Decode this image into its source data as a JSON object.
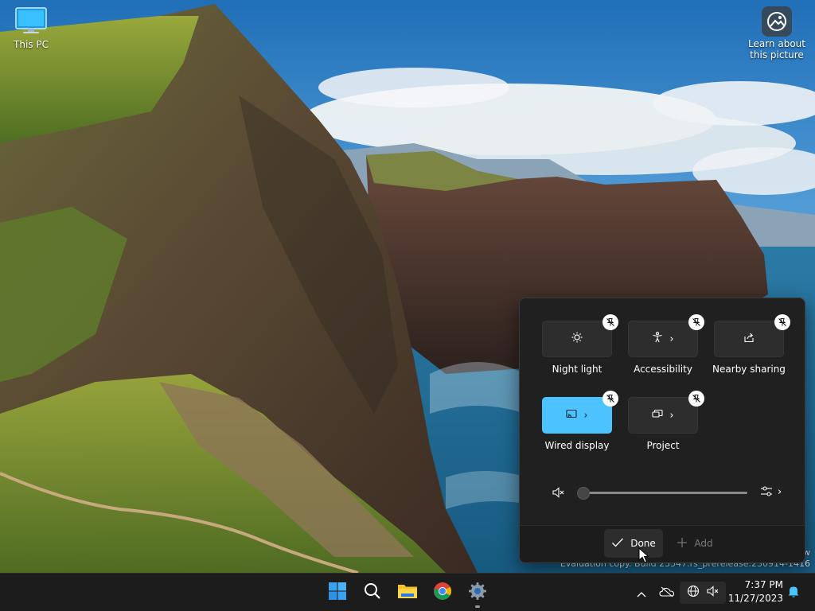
{
  "desktop": {
    "icons": [
      {
        "label": "This PC",
        "icon": "this-pc-icon"
      },
      {
        "label": "Learn about\nthis picture",
        "icon": "learn-picture-icon"
      }
    ],
    "watermark_line1": "w",
    "watermark_line2": "Evaluation copy. Build 23547.rs_prerelease.230914-1416"
  },
  "quick_settings": {
    "mode": "edit",
    "tiles": [
      {
        "label": "Night light",
        "icon": "night-light-icon",
        "has_submenu": false,
        "active": false
      },
      {
        "label": "Accessibility",
        "icon": "accessibility-icon",
        "has_submenu": true,
        "active": false
      },
      {
        "label": "Nearby sharing",
        "icon": "nearby-sharing-icon",
        "has_submenu": false,
        "active": false
      },
      {
        "label": "Wired display",
        "icon": "cast-icon",
        "has_submenu": true,
        "active": true
      },
      {
        "label": "Project",
        "icon": "project-icon",
        "has_submenu": true,
        "active": false
      }
    ],
    "volume": {
      "muted": true,
      "level": 0
    },
    "footer": {
      "done_label": "Done",
      "add_label": "Add"
    }
  },
  "taskbar": {
    "apps": [
      {
        "name": "Start",
        "icon": "windows-start-icon"
      },
      {
        "name": "Search",
        "icon": "search-icon"
      },
      {
        "name": "File Explorer",
        "icon": "file-explorer-icon"
      },
      {
        "name": "Google Chrome",
        "icon": "chrome-icon"
      },
      {
        "name": "Settings",
        "icon": "settings-gear-icon",
        "running": true
      }
    ],
    "tray_icons": [
      "chevron-up-icon",
      "onedrive-offline-icon",
      "network-globe-icon",
      "volume-muted-icon",
      "notification-bell-icon"
    ],
    "time": "7:37 PM",
    "date": "11/27/2023"
  },
  "colors": {
    "accent": "#4cc2ff",
    "panel_bg": "#202020",
    "taskbar_bg": "#1c1c1c",
    "notification_bell": "#4cc2ff"
  }
}
